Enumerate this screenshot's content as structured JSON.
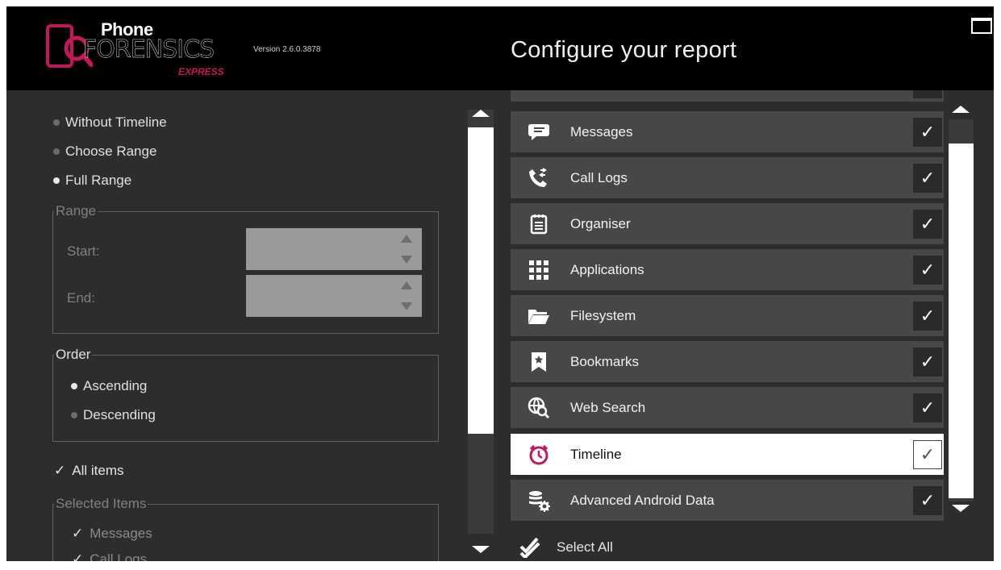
{
  "app": {
    "logo_top": "Phone",
    "logo_main": "FORENSICS",
    "logo_sub": "EXPRESS",
    "version": "Version 2.6.0.3878",
    "title": "Configure your report",
    "accent_color": "#c2185b"
  },
  "timeline_options": [
    {
      "label": "Without Timeline",
      "selected": false
    },
    {
      "label": "Choose Range",
      "selected": false
    },
    {
      "label": "Full Range",
      "selected": true
    }
  ],
  "range": {
    "legend": "Range",
    "start_label": "Start:",
    "end_label": "End:",
    "start_value": "",
    "end_value": ""
  },
  "order": {
    "legend": "Order",
    "options": [
      {
        "label": "Ascending",
        "selected": true
      },
      {
        "label": "Descending",
        "selected": false
      }
    ]
  },
  "all_items": {
    "label": "All items",
    "checked": true
  },
  "selected_items": {
    "legend": "Selected Items",
    "items": [
      {
        "label": "Messages",
        "checked": true
      },
      {
        "label": "Call Logs",
        "checked": true
      }
    ]
  },
  "report_items": [
    {
      "label": "Messages",
      "icon": "message-icon",
      "checked": true
    },
    {
      "label": "Call Logs",
      "icon": "call-log-icon",
      "checked": true
    },
    {
      "label": "Organiser",
      "icon": "organiser-icon",
      "checked": true
    },
    {
      "label": "Applications",
      "icon": "applications-grid-icon",
      "checked": true
    },
    {
      "label": "Filesystem",
      "icon": "folder-icon",
      "checked": true
    },
    {
      "label": "Bookmarks",
      "icon": "bookmark-icon",
      "checked": true
    },
    {
      "label": "Web Search",
      "icon": "web-search-icon",
      "checked": true
    },
    {
      "label": "Timeline",
      "icon": "timeline-icon",
      "checked": true
    },
    {
      "label": "Advanced Android Data",
      "icon": "database-gear-icon",
      "checked": true
    }
  ],
  "select_all": {
    "label": "Select All"
  },
  "checkmark": "✓"
}
